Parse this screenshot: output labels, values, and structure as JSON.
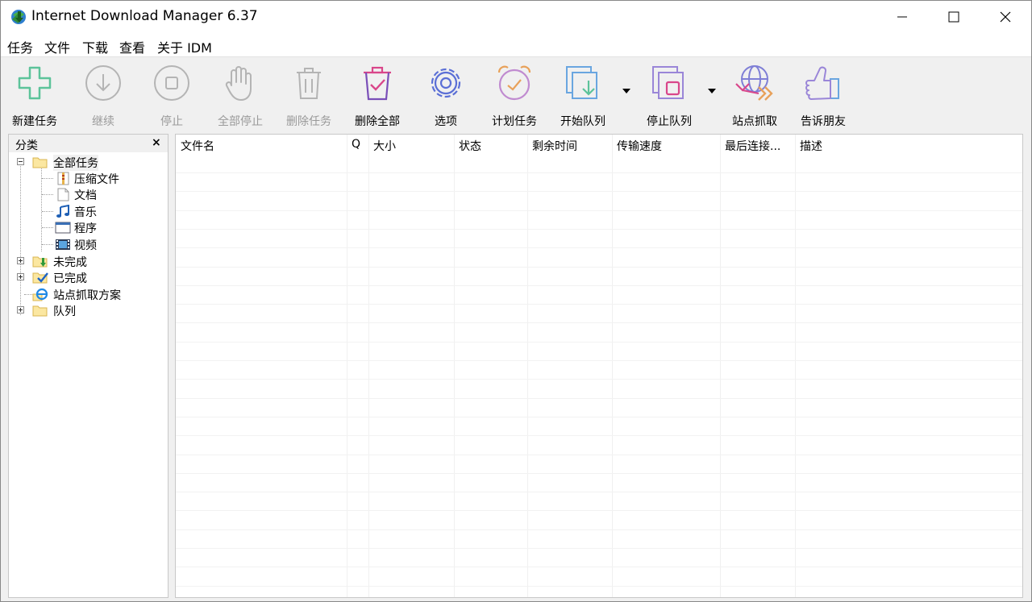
{
  "window": {
    "title": "Internet Download Manager 6.37"
  },
  "menu": [
    "任务",
    "文件",
    "下载",
    "查看",
    "关于 IDM"
  ],
  "toolbar": {
    "new_task": "新建任务",
    "resume": "继续",
    "stop": "停止",
    "stop_all": "全部停止",
    "delete_task": "删除任务",
    "delete_all": "删除全部",
    "options": "选项",
    "scheduler": "计划任务",
    "start_queue": "开始队列",
    "stop_queue": "停止队列",
    "site_grabber": "站点抓取",
    "tell_friend": "告诉朋友"
  },
  "categories": {
    "title": "分类",
    "close": "×",
    "all_tasks": "全部任务",
    "compressed": "压缩文件",
    "documents": "文档",
    "music": "音乐",
    "programs": "程序",
    "video": "视频",
    "unfinished": "未完成",
    "finished": "已完成",
    "grabber_projects": "站点抓取方案",
    "queues": "队列"
  },
  "columns": [
    "文件名",
    "Q",
    "大小",
    "状态",
    "剩余时间",
    "传输速度",
    "最后连接...",
    "描述"
  ],
  "colors": {
    "accent_green": "#5cc39a",
    "disabled_gray": "#b4b4b4",
    "delete_pink": "#d9468a",
    "options_blue": "#5b6fd6",
    "scheduler_orange": "#e8a15a"
  }
}
